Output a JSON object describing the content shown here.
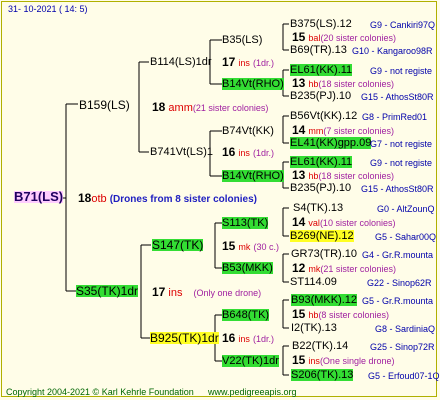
{
  "header": {
    "date": "31-  10-2021  (  14:   5)"
  },
  "footer": {
    "copyright": "Copyright 2004-2021 © Karl Kehrle Foundation",
    "url": "www.pedigreeapis.org"
  },
  "root": {
    "label": "B71(LS)",
    "num": "18",
    "code": "otb",
    "note": "(Drones from 8 sister colonies)"
  },
  "upper": {
    "node": "B159(LS)",
    "num": "18",
    "code": "amm",
    "note": "(21 sister colonies)",
    "a": {
      "node": "B114(LS)1dr",
      "num": "17",
      "code": "ins",
      "note": "(1dr.)",
      "b1": {
        "node": "B35(LS)",
        "l1": {
          "name": "B375(LS).12",
          "info": "G9 - Cankiri97Q"
        },
        "mid": {
          "num": "15",
          "code": "bal",
          "note": "(20 sister colonies)"
        },
        "l2": {
          "name": "B69(TR).13",
          "info": "G10 - Kangaroo98R"
        }
      },
      "b2": {
        "node": "B14Vt(RHO)",
        "l1": {
          "name": "EL61(KK).11",
          "info": "G9 - not registe"
        },
        "mid": {
          "num": "13",
          "code": "hb",
          "note": "(18 sister colonies)"
        },
        "l2": {
          "name": "B235(PJ).10",
          "info": "G15 - AthosSt80R"
        }
      }
    },
    "b": {
      "node": "B741Vt(LS)1",
      "num": "16",
      "code": "ins",
      "note": "(1dr.)",
      "b1": {
        "node": "B74Vt(KK)",
        "l1": {
          "name": "B56Vt(KK).12",
          "info": "G8 - PrimRed01"
        },
        "mid": {
          "num": "14",
          "code": "mm",
          "note": "(7 sister colonies)"
        },
        "l2": {
          "name": "EL41(KK)gpp.09",
          "info": "G7 - not registe"
        }
      },
      "b2": {
        "node": "B14Vt(RHO)",
        "l1": {
          "name": "EL61(KK).11",
          "info": "G9 - not registe"
        },
        "mid": {
          "num": "13",
          "code": "hb",
          "note": "(18 sister colonies)"
        },
        "l2": {
          "name": "B235(PJ).10",
          "info": "G15 - AthosSt80R"
        }
      }
    }
  },
  "lower": {
    "node": "S35(TK)1dr",
    "num": "17",
    "code": "ins",
    "note": "(Only one drone)",
    "a": {
      "node": "S147(TK)",
      "num": "15",
      "code": "mk",
      "note": "(30 c.)",
      "b1": {
        "node": "S113(TK)",
        "l1": {
          "name": "S4(TK).13",
          "info": "G0 - AltZounQ"
        },
        "mid": {
          "num": "14",
          "code": "val",
          "note": "(10 sister colonies)"
        },
        "l2": {
          "name": "B269(NE).12",
          "info": "G5 - Sahar00Q"
        }
      },
      "b2": {
        "node": "B53(MKK)",
        "l1": {
          "name": "GR73(TR).10",
          "info": "G4 - Gr.R.mounta"
        },
        "mid": {
          "num": "12",
          "code": "mk",
          "note": "(21 sister colonies)"
        },
        "l2": {
          "name": "ST114.09",
          "info": "G22 - Sinop62R"
        }
      }
    },
    "b": {
      "node": "B925(TK)1dr",
      "num": "16",
      "code": "ins",
      "note": "(1dr.)",
      "b1": {
        "node": "B648(TK)",
        "l1": {
          "name": "B93(MKK).12",
          "info": "G5 - Gr.R.mounta"
        },
        "mid": {
          "num": "15",
          "code": "hb",
          "note": "(8 sister colonies)"
        },
        "l2": {
          "name": "I2(TK).13",
          "info": "G8 - SardiniaQ"
        }
      },
      "b2": {
        "node": "V22(TK)1dr",
        "l1": {
          "name": "B22(TK).14",
          "info": "G25 - Sinop72R"
        },
        "mid": {
          "num": "15",
          "code": "ins",
          "note": "(One single drone)"
        },
        "l2": {
          "name": "S206(TK).13",
          "info": "G5 - Erfoud07-1Q"
        }
      }
    }
  }
}
